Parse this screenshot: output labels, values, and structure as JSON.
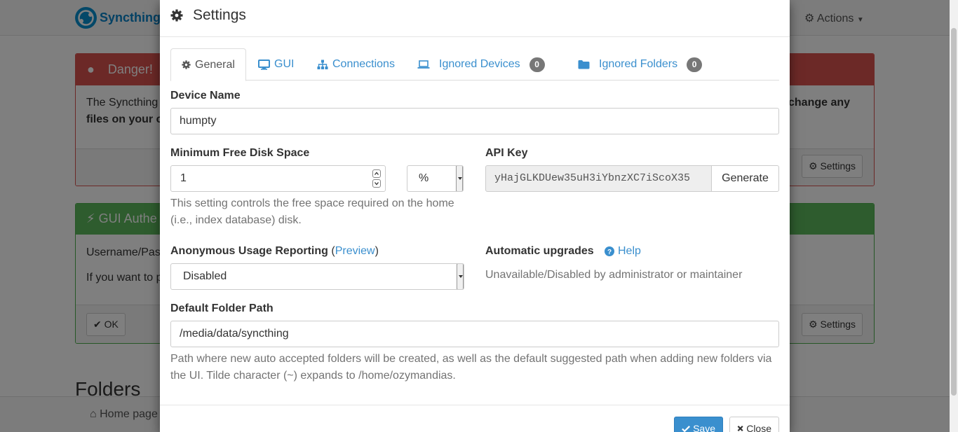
{
  "background": {
    "brand": "Syncthing",
    "actions_label": "Actions",
    "danger_title": "Danger!",
    "danger_text_left_1": "The Syncthing",
    "danger_text_left_2": "files on your c",
    "danger_text_right_1": "change any",
    "danger_settings_label": "Settings",
    "gui_auth_title": "GUI Authe",
    "gui_auth_text_1": "Username/Pas",
    "gui_auth_text_2": "If you want to p",
    "ok_label": "OK",
    "gui_settings_label": "Settings",
    "folders_title": "Folders",
    "home_page_label": "Home page"
  },
  "modal": {
    "title": "Settings",
    "tabs": [
      {
        "label": "General",
        "icon": "gear-icon"
      },
      {
        "label": "GUI",
        "icon": "desktop-icon"
      },
      {
        "label": "Connections",
        "icon": "sitemap-icon"
      },
      {
        "label": "Ignored Devices",
        "icon": "laptop-icon",
        "badge": "0"
      },
      {
        "label": "Ignored Folders",
        "icon": "folder-icon",
        "badge": "0"
      }
    ],
    "device_name": {
      "label": "Device Name",
      "value": "humpty"
    },
    "min_disk": {
      "label": "Minimum Free Disk Space",
      "value": "1",
      "unit": "%",
      "help": "This setting controls the free space required on the home (i.e., index database) disk."
    },
    "api_key": {
      "label": "API Key",
      "value": "yHajGLKDUew35uH3iYbnzXC7iScoX35",
      "generate_label": "Generate"
    },
    "usage_reporting": {
      "label": "Anonymous Usage Reporting",
      "open_paren": "(",
      "preview_link": "Preview",
      "close_paren": ")",
      "value": "Disabled"
    },
    "auto_upgrades": {
      "label": "Automatic upgrades",
      "help_link": "Help",
      "status": "Unavailable/Disabled by administrator or maintainer"
    },
    "default_folder": {
      "label": "Default Folder Path",
      "value": "/media/data/syncthing",
      "help": "Path where new auto accepted folders will be created, as well as the default suggested path when adding new folders via the UI. Tilde character (~) expands to /home/ozymandias."
    },
    "save_label": "Save",
    "close_label": "Close"
  },
  "colors": {
    "primary": "#3a8fce",
    "danger": "#d9534f",
    "success": "#5cb85c",
    "badge": "#777777"
  }
}
